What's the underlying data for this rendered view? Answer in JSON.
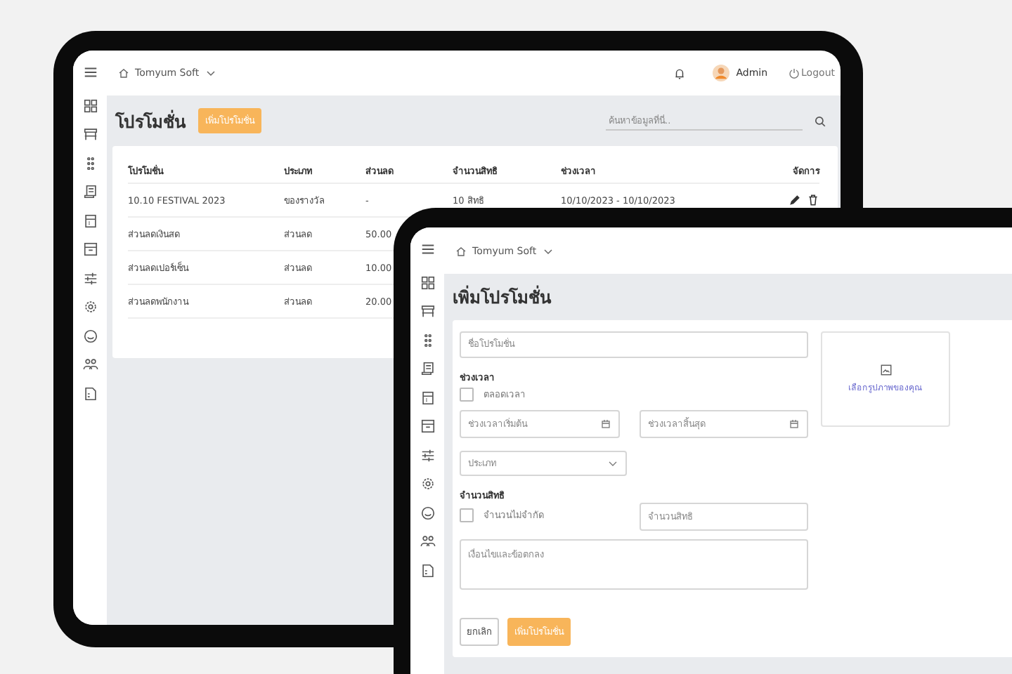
{
  "list_screen": {
    "header": {
      "company": "Tomyum Soft",
      "user": "Admin",
      "logout": "Logout"
    },
    "title": "โปรโมชั่น",
    "add_button": "เพิ่มโปรโมชั่น",
    "search": {
      "placeholder": "ค้นหาข้อมูลที่นี่.."
    },
    "table": {
      "columns": [
        "โปรโมชั่น",
        "ประเภท",
        "ส่วนลด",
        "จำนวนสิทธิ",
        "ช่วงเวลา",
        "จัดการ"
      ],
      "rows": [
        {
          "cells": [
            "10.10 FESTIVAL 2023",
            "ของรางวัล",
            "-",
            "10 สิทธิ",
            "10/10/2023 - 10/10/2023"
          ],
          "actions": true
        },
        {
          "cells": [
            "ส่วนลดเงินสด",
            "ส่วนลด",
            "50.00"
          ]
        },
        {
          "cells": [
            "ส่วนลดเปอร์เซ็น",
            "ส่วนลด",
            "10.00"
          ]
        },
        {
          "cells": [
            "ส่วนลดพนักงาน",
            "ส่วนลด",
            "20.00"
          ]
        }
      ]
    }
  },
  "form_screen": {
    "header": {
      "company": "Tomyum Soft"
    },
    "title": "เพิ่มโปรโมชั่น",
    "name_field": {
      "placeholder": "ชื่อโปรโมชั่น"
    },
    "period": {
      "label": "ช่วงเวลา",
      "all_time": {
        "label": "ตลอดเวลา",
        "checked": false
      },
      "start": {
        "placeholder": "ช่วงเวลาเริ่มต้น"
      },
      "end": {
        "placeholder": "ช่วงเวลาสิ้นสุด"
      }
    },
    "type_select": {
      "placeholder": "ประเภท"
    },
    "quota": {
      "label": "จำนวนสิทธิ",
      "unlimited": {
        "label": "จำนวนไม่จำกัด",
        "checked": false
      },
      "amount": {
        "placeholder": "จำนวนสิทธิ"
      }
    },
    "terms": {
      "placeholder": "เงื่อนไขและข้อตกลง"
    },
    "image_upload": {
      "label": "เลือกรูปภาพของคุณ"
    },
    "buttons": {
      "cancel": "ยกเลิก",
      "submit": "เพิ่มโปรโมชั่น"
    }
  }
}
